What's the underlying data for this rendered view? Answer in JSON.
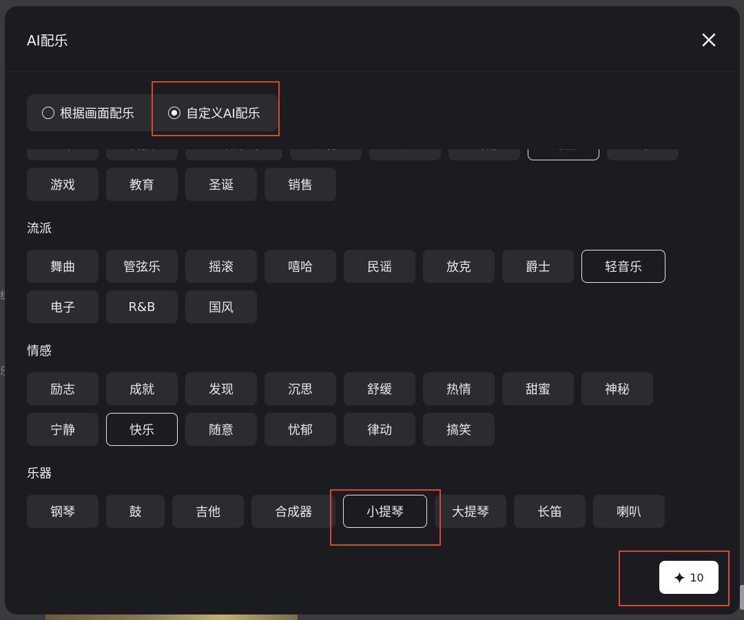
{
  "background": {
    "side_text_1": "统",
    "side_text_2": "乐"
  },
  "modal": {
    "title": "AI配乐",
    "close_icon": "close-icon"
  },
  "mode": {
    "options": [
      {
        "label": "根据画面配乐",
        "checked": false
      },
      {
        "label": "自定义AI配乐",
        "checked": true
      }
    ]
  },
  "sections": {
    "scenes": {
      "row1": [
        "日常",
        "科技",
        "生活方式",
        "旅行",
        "冥想",
        "戏剧",
        "儿童",
        "电影"
      ],
      "row2": [
        "游戏",
        "教育",
        "圣诞",
        "销售"
      ],
      "selected": "儿童"
    },
    "genre": {
      "label": "流派",
      "row1": [
        "舞曲",
        "管弦乐",
        "摇滚",
        "嘻哈",
        "民谣",
        "放克",
        "爵士",
        "轻音乐"
      ],
      "row2": [
        "电子",
        "R&B",
        "国风"
      ],
      "selected": "轻音乐"
    },
    "emotion": {
      "label": "情感",
      "row1": [
        "励志",
        "成就",
        "发现",
        "沉思",
        "舒缓",
        "热情",
        "甜蜜",
        "神秘"
      ],
      "row2": [
        "宁静",
        "快乐",
        "随意",
        "忧郁",
        "律动",
        "搞笑"
      ],
      "selected": "快乐"
    },
    "instrument": {
      "label": "乐器",
      "row1": [
        "钢琴",
        "鼓",
        "吉他",
        "合成器",
        "小提琴",
        "大提琴",
        "长笛",
        "喇叭"
      ],
      "selected": "小提琴"
    }
  },
  "generate": {
    "icon": "sparkle-icon",
    "cost": "10"
  },
  "colors": {
    "accent_highlight": "#e0452d",
    "modal_bg": "#1b1c1f",
    "chip_bg": "#2b2c30"
  }
}
